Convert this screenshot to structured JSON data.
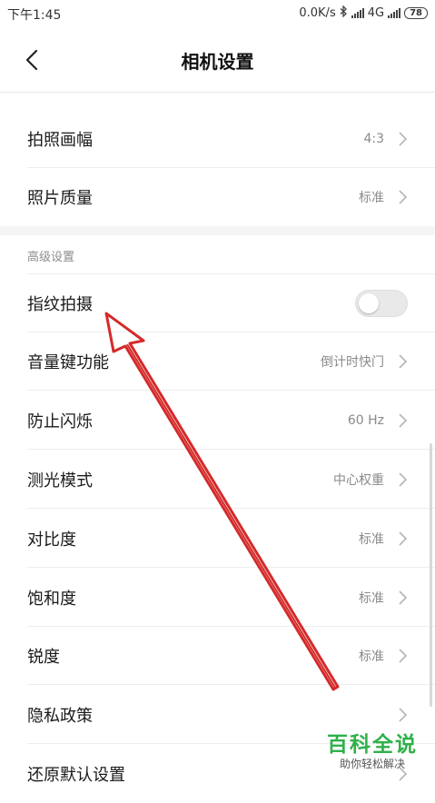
{
  "status_bar": {
    "time": "下午1:45",
    "speed": "0.0K/s",
    "network": "4G",
    "battery": "78"
  },
  "header": {
    "title": "相机设置"
  },
  "rows_top": [
    {
      "label": "拍照画幅",
      "value": "4:3"
    },
    {
      "label": "照片质量",
      "value": "标准"
    }
  ],
  "advanced": {
    "section_title": "高级设置",
    "fingerprint": {
      "label": "指纹拍摄",
      "enabled": false
    },
    "rows": [
      {
        "label": "音量键功能",
        "value": "倒计时快门"
      },
      {
        "label": "防止闪烁",
        "value": "60 Hz"
      },
      {
        "label": "测光模式",
        "value": "中心权重"
      },
      {
        "label": "对比度",
        "value": "标准"
      },
      {
        "label": "饱和度",
        "value": "标准"
      },
      {
        "label": "锐度",
        "value": "标准"
      },
      {
        "label": "隐私政策",
        "value": ""
      },
      {
        "label": "还原默认设置",
        "value": ""
      }
    ]
  },
  "watermark": {
    "main": "百科全说",
    "sub": "助你轻松解决"
  },
  "colors": {
    "arrow": "#d42a2a",
    "watermark": "#2fb14a"
  }
}
